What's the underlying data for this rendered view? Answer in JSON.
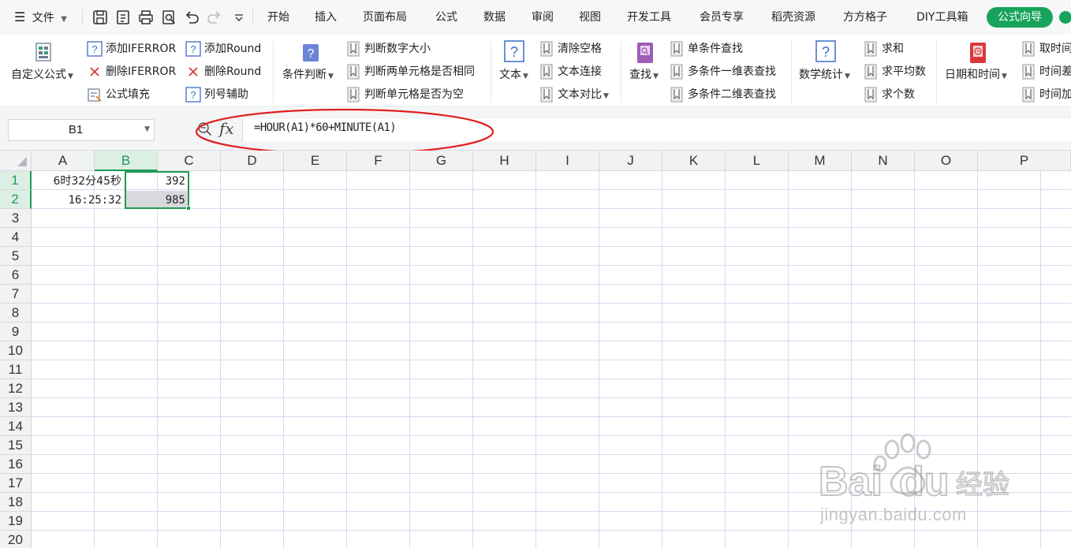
{
  "menubar": {
    "file_label": "文件",
    "tabs": [
      "开始",
      "插入",
      "页面布局",
      "公式",
      "数据",
      "审阅",
      "视图",
      "开发工具",
      "会员专享",
      "稻壳资源",
      "方方格子",
      "DIY工具箱"
    ],
    "active_tab": "公式向导"
  },
  "ribbon": {
    "custom_formula": "自定义公式",
    "add_iferror": "添加IFERROR",
    "remove_iferror": "删除IFERROR",
    "formula_fill": "公式填充",
    "add_round": "添加Round",
    "remove_round": "删除Round",
    "column_helper": "列号辅助",
    "condition_judge": "条件判断",
    "judge_number_size": "判断数字大小",
    "judge_two_cells_same": "判断两单元格是否相同",
    "judge_cell_empty": "判断单元格是否为空",
    "text": "文本",
    "clear_spaces": "清除空格",
    "text_concat": "文本连接",
    "text_compare": "文本对比",
    "lookup": "查找",
    "single_condition_lookup": "单条件查找",
    "multi_condition_1d_lookup": "多条件一维表查找",
    "multi_condition_2d_lookup": "多条件二维表查找",
    "math_stats": "数学统计",
    "sum": "求和",
    "average": "求平均数",
    "count": "求个数",
    "date_time": "日期和时间",
    "get_time": "取时间",
    "time_diff": "时间差",
    "time_add": "时间加"
  },
  "formula_bar": {
    "cell_ref": "B1",
    "fx_label": "fx",
    "formula": "=HOUR(A1)*60+MINUTE(A1)"
  },
  "grid": {
    "columns": [
      "A",
      "B",
      "C",
      "D",
      "E",
      "F",
      "G",
      "H",
      "I",
      "J",
      "K",
      "L",
      "M",
      "N",
      "O",
      "P"
    ],
    "rows": [
      "1",
      "2",
      "3",
      "4",
      "5",
      "6",
      "7",
      "8",
      "9",
      "10",
      "11",
      "12",
      "13",
      "14",
      "15",
      "16",
      "17",
      "18",
      "19",
      "20"
    ],
    "cells": {
      "A1": "6时32分45秒",
      "B1": "392",
      "A2": "16:25:32",
      "B2": "985"
    }
  },
  "watermark": {
    "url": "jingyan.baidu.com"
  },
  "colors": {
    "accent_green": "#1f9a55",
    "tab_green": "#17a35c",
    "annotation_red": "#e02020"
  }
}
